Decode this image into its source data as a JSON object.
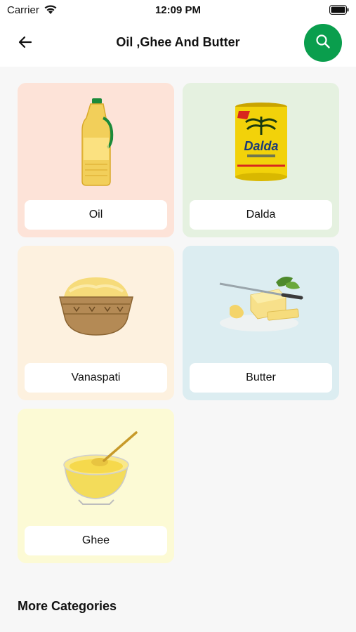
{
  "status": {
    "carrier": "Carrier",
    "time": "12:09 PM"
  },
  "header": {
    "title": "Oil ,Ghee And Butter"
  },
  "icons": {
    "back": "arrow-left-icon",
    "search": "search-icon"
  },
  "colors": {
    "accent": "#0a9e4d"
  },
  "categories": [
    {
      "label": "Oil",
      "bg": "#fde3d8"
    },
    {
      "label": "Dalda",
      "bg": "#e5f1e0"
    },
    {
      "label": "Vanaspati",
      "bg": "#fdf1df"
    },
    {
      "label": "Butter",
      "bg": "#dcedf1"
    },
    {
      "label": "Ghee",
      "bg": "#fcfad5"
    }
  ],
  "more": {
    "heading": "More Categories"
  }
}
